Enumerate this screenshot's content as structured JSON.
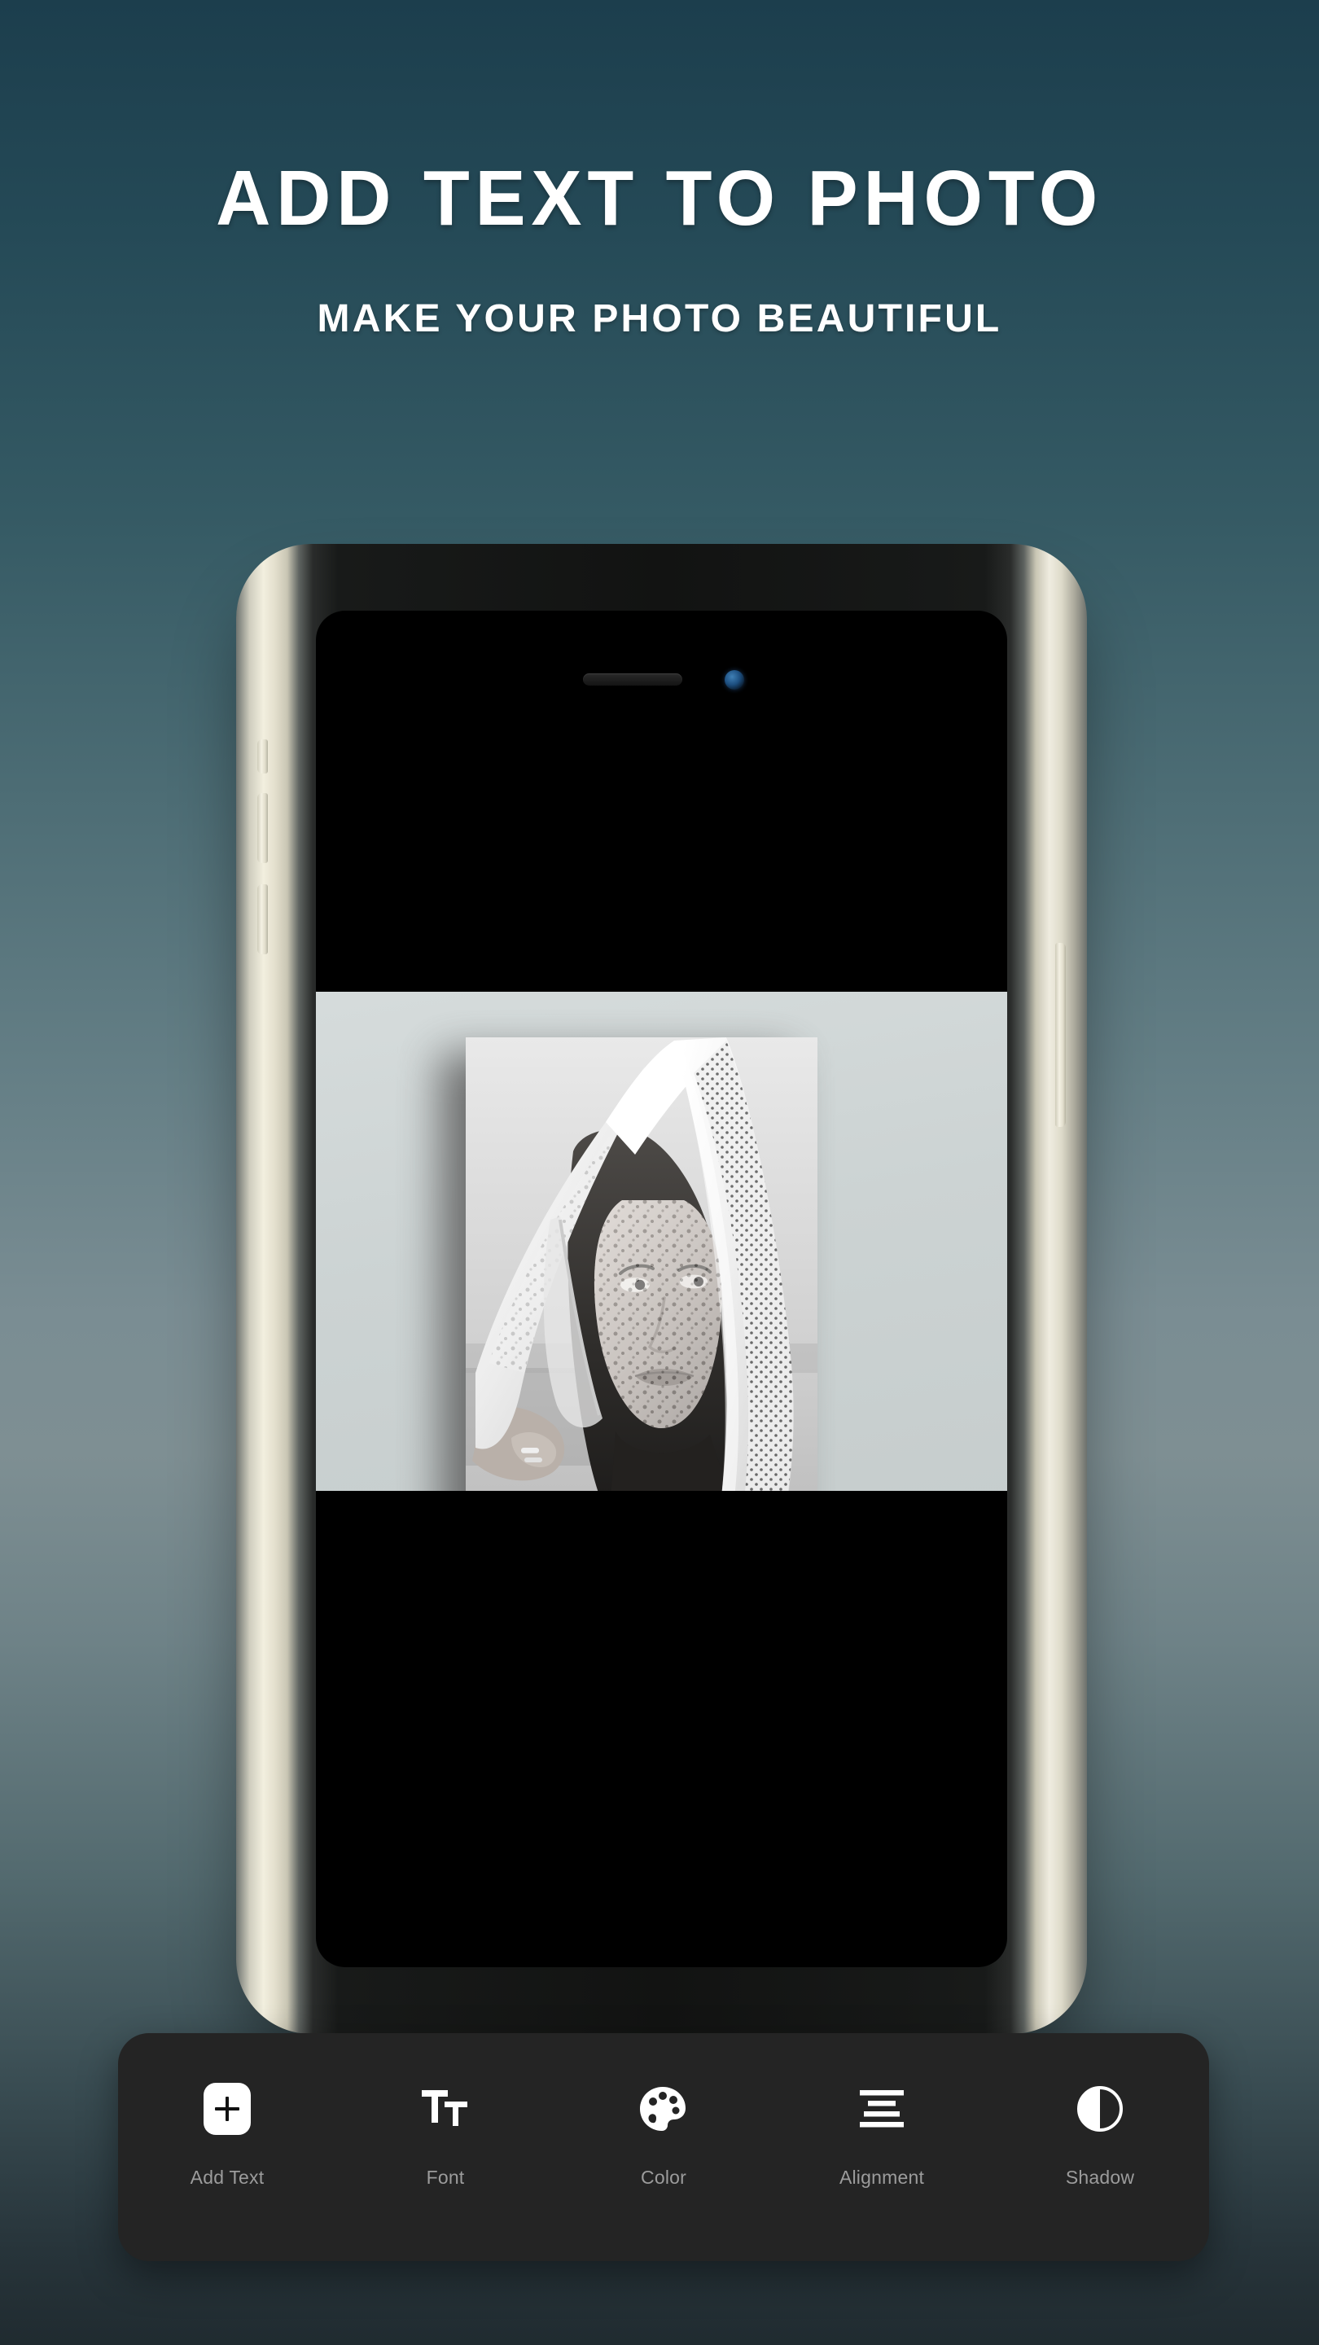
{
  "page": {
    "headline": "ADD TEXT TO PHOTO",
    "subheadline": "MAKE YOUR PHOTO BEAUTIFUL",
    "background_gradient_top": "#1c3e4d",
    "background_gradient_mid": "#7e8f93",
    "background_gradient_bottom": "#202b30",
    "headline_color": "#ffffff"
  },
  "device": {
    "frame_color": "#efece0",
    "screen_color": "#000000",
    "canvas_color": "#ccd4d4",
    "earpiece": "speaker-grille",
    "front_camera": "front-camera-lens",
    "front_camera_color": "#2e6ea4",
    "buttons": [
      {
        "name": "silent-switch",
        "side": "left"
      },
      {
        "name": "volume-up-button",
        "side": "left"
      },
      {
        "name": "volume-down-button",
        "side": "left"
      },
      {
        "name": "power-button",
        "side": "right"
      }
    ]
  },
  "editor": {
    "photo_alt": "black and white portrait of a woman with a lace veil over her head",
    "photo_filter": "grayscale"
  },
  "toolbar": {
    "background_color": "#242424",
    "label_color": "#9c9c9c",
    "items": [
      {
        "label": "Add Text",
        "icon": "plus-square-icon"
      },
      {
        "label": "Font",
        "icon": "font-size-icon"
      },
      {
        "label": "Color",
        "icon": "paint-palette-icon"
      },
      {
        "label": "Alignment",
        "icon": "align-center-icon"
      },
      {
        "label": "Shadow",
        "icon": "contrast-half-circle-icon"
      }
    ]
  }
}
